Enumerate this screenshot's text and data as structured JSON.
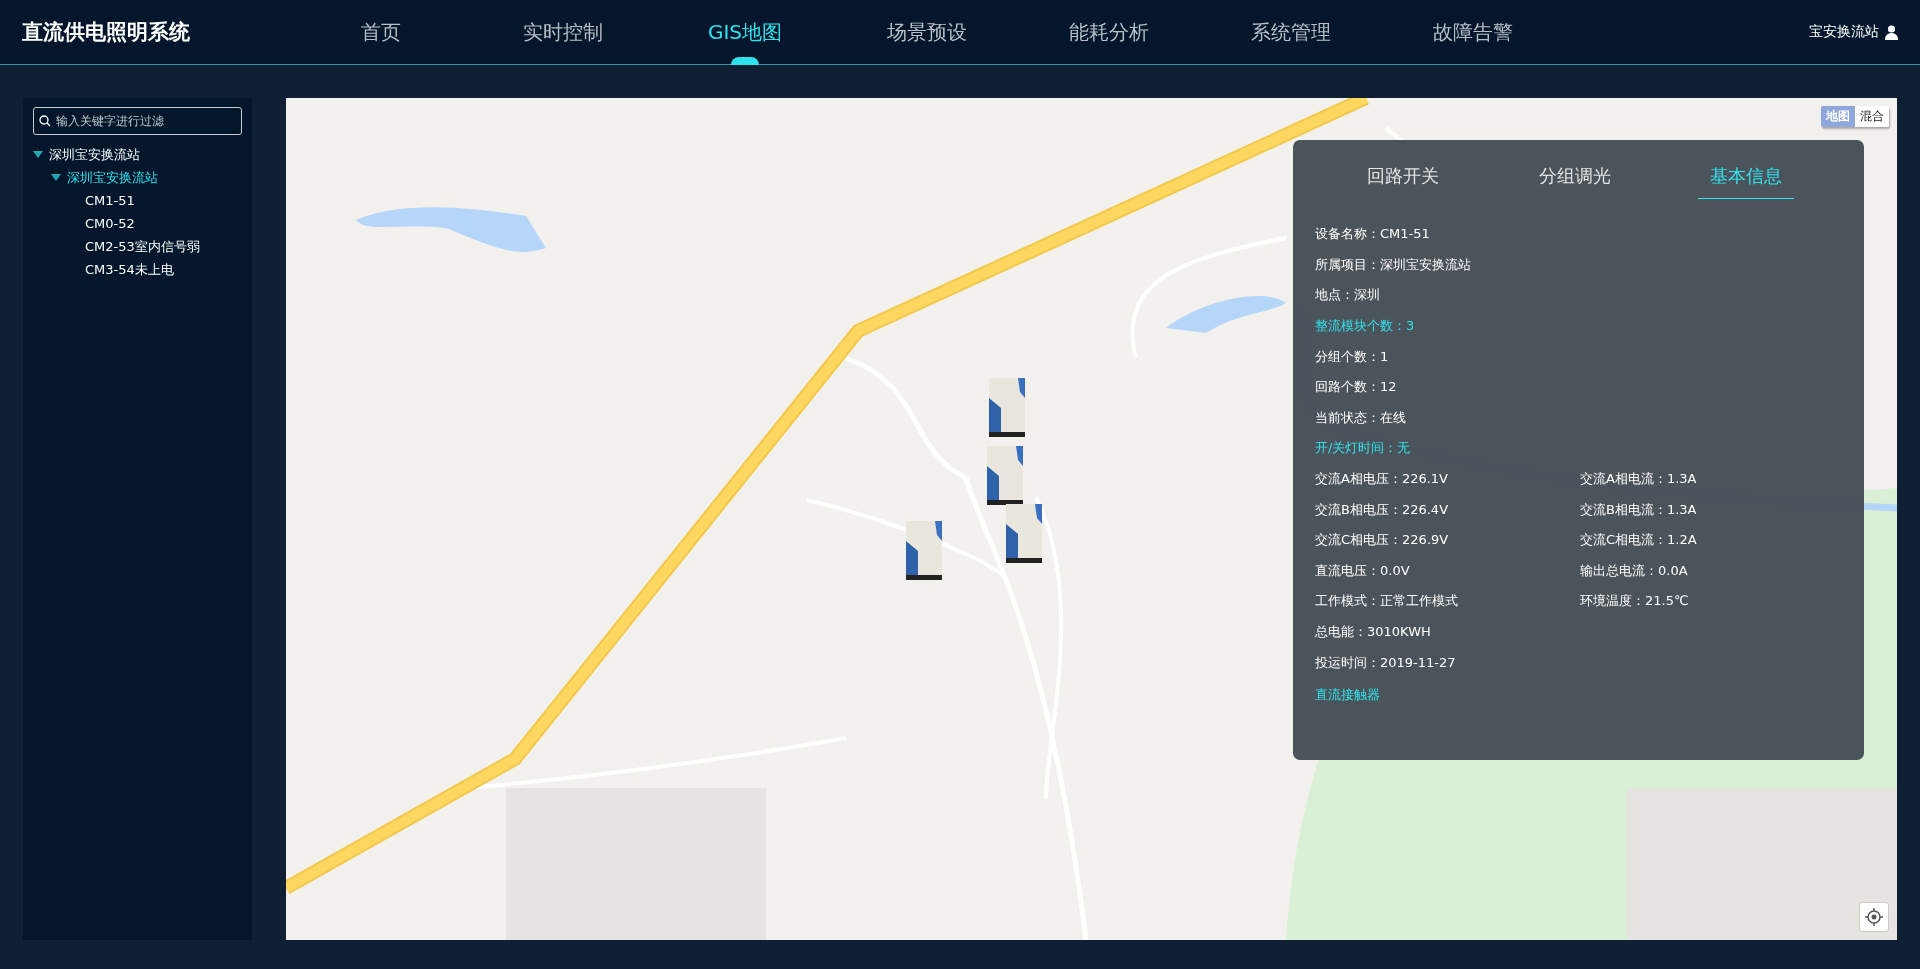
{
  "header": {
    "title": "直流供电照明系统",
    "nav": [
      {
        "label": "首页",
        "selected": false
      },
      {
        "label": "实时控制",
        "selected": false
      },
      {
        "label": "GIS地图",
        "selected": true
      },
      {
        "label": "场景预设",
        "selected": false
      },
      {
        "label": "能耗分析",
        "selected": false
      },
      {
        "label": "系统管理",
        "selected": false
      },
      {
        "label": "故障告警",
        "selected": false
      }
    ],
    "user": "宝安换流站"
  },
  "sidebar": {
    "search": {
      "placeholder": "输入关键字进行过滤"
    },
    "tree": [
      {
        "label": "深圳宝安换流站",
        "selected": false,
        "expanded": true,
        "children": [
          {
            "label": "深圳宝安换流站",
            "selected": true,
            "expanded": true,
            "children": [
              {
                "label": "CM1-51",
                "selected": false
              },
              {
                "label": "CM0-52",
                "selected": false
              },
              {
                "label": "CM2-53室内信号弱",
                "selected": false
              },
              {
                "label": "CM3-54未上电",
                "selected": false
              }
            ]
          }
        ]
      }
    ]
  },
  "map": {
    "type_switch": [
      {
        "label": "地图",
        "selected": true
      },
      {
        "label": "混合",
        "selected": false
      }
    ],
    "info_panel": {
      "tabs": [
        {
          "label": "回路开关",
          "selected": false
        },
        {
          "label": "分组调光",
          "selected": false
        },
        {
          "label": "基本信息",
          "selected": true
        }
      ],
      "rows": [
        [
          {
            "text": "设备名称：CM1-51",
            "highlighted": false
          }
        ],
        [
          {
            "text": "所属项目：深圳宝安换流站",
            "highlighted": false
          }
        ],
        [
          {
            "text": "地点：深圳",
            "highlighted": false
          }
        ],
        [
          {
            "text": "整流模块个数：3",
            "highlighted": true
          }
        ],
        [
          {
            "text": "分组个数：1",
            "highlighted": false
          }
        ],
        [
          {
            "text": "回路个数：12",
            "highlighted": false
          }
        ],
        [
          {
            "text": "当前状态：在线",
            "highlighted": false
          }
        ],
        [
          {
            "text": "开/关灯时间：无",
            "highlighted": true
          }
        ],
        [
          {
            "text": "交流A相电压：226.1V",
            "highlighted": false
          },
          {
            "text": "交流A相电流：1.3A",
            "highlighted": false
          }
        ],
        [
          {
            "text": "交流B相电压：226.4V",
            "highlighted": false
          },
          {
            "text": "交流B相电流：1.3A",
            "highlighted": false
          }
        ],
        [
          {
            "text": "交流C相电压：226.9V",
            "highlighted": false
          },
          {
            "text": "交流C相电流：1.2A",
            "highlighted": false
          }
        ],
        [
          {
            "text": "直流电压：0.0V",
            "highlighted": false
          },
          {
            "text": "输出总电流：0.0A",
            "highlighted": false
          }
        ],
        [
          {
            "text": "工作模式：正常工作模式",
            "highlighted": false
          },
          {
            "text": "环境温度：21.5℃",
            "highlighted": false
          }
        ],
        [
          {
            "text": "总电能：3010KWH",
            "highlighted": false
          }
        ],
        [
          {
            "text": "投运时间：2019-11-27",
            "highlighted": false
          }
        ]
      ],
      "link": "直流接触器"
    }
  }
}
